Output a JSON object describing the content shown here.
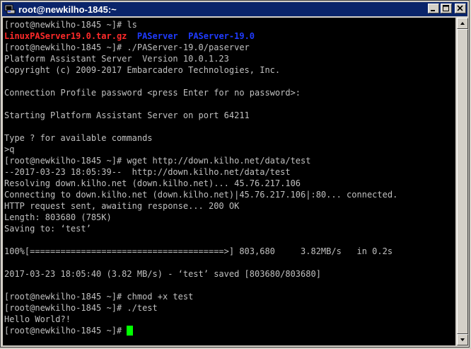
{
  "window": {
    "title": "root@newkilho-1845:~"
  },
  "terminal": {
    "lines": [
      {
        "prompt": "[root@newkilho-1845 ~]# ",
        "text": "ls"
      },
      {
        "files": [
          "LinuxPAServer19.0.tar.gz",
          "PAServer",
          "PAServer-19.0"
        ]
      },
      {
        "prompt": "[root@newkilho-1845 ~]# ",
        "text": "./PAServer-19.0/paserver"
      },
      {
        "text": "Platform Assistant Server  Version 10.0.1.23"
      },
      {
        "text": "Copyright (c) 2009-2017 Embarcadero Technologies, Inc."
      },
      {
        "text": ""
      },
      {
        "text": "Connection Profile password <press Enter for no password>:"
      },
      {
        "text": ""
      },
      {
        "text": "Starting Platform Assistant Server on port 64211"
      },
      {
        "text": ""
      },
      {
        "text": "Type ? for available commands"
      },
      {
        "text": ">q"
      },
      {
        "prompt": "[root@newkilho-1845 ~]# ",
        "text": "wget http://down.kilho.net/data/test"
      },
      {
        "text": "--2017-03-23 18:05:39--  http://down.kilho.net/data/test"
      },
      {
        "text": "Resolving down.kilho.net (down.kilho.net)... 45.76.217.106"
      },
      {
        "text": "Connecting to down.kilho.net (down.kilho.net)|45.76.217.106|:80... connected."
      },
      {
        "text": "HTTP request sent, awaiting response... 200 OK"
      },
      {
        "text": "Length: 803680 (785K)"
      },
      {
        "text": "Saving to: ‘test’"
      },
      {
        "text": ""
      },
      {
        "text": "100%[======================================>] 803,680     3.82MB/s   in 0.2s"
      },
      {
        "text": ""
      },
      {
        "text": "2017-03-23 18:05:40 (3.82 MB/s) - ‘test’ saved [803680/803680]"
      },
      {
        "text": ""
      },
      {
        "prompt": "[root@newkilho-1845 ~]# ",
        "text": "chmod +x test"
      },
      {
        "prompt": "[root@newkilho-1845 ~]# ",
        "text": "./test"
      },
      {
        "text": "Hello World?!"
      },
      {
        "prompt": "[root@newkilho-1845 ~]# ",
        "text": "",
        "cursor": true
      }
    ]
  },
  "colors": {
    "background": "#000000",
    "foreground": "#c0c0c0",
    "file_archive": "#ff2a2a",
    "file_directory": "#1f3bff",
    "cursor": "#00ff00",
    "titlebar": "#0a246a"
  },
  "icons": {
    "window_icon": "putty-terminal-icon",
    "minimize": "minimize-icon",
    "maximize": "maximize-icon",
    "close": "close-icon"
  }
}
